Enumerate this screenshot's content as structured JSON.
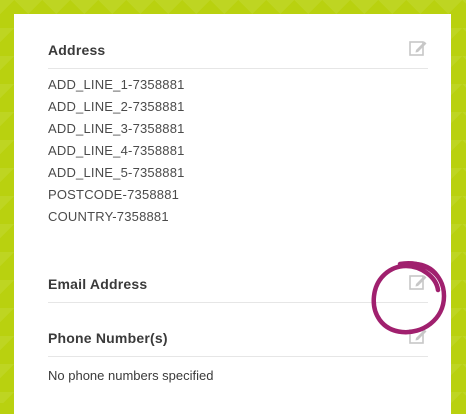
{
  "sections": {
    "address": {
      "title": "Address",
      "lines": [
        "ADD_LINE_1-7358881",
        "ADD_LINE_2-7358881",
        "ADD_LINE_3-7358881",
        "ADD_LINE_4-7358881",
        "ADD_LINE_5-7358881",
        "POSTCODE-7358881",
        "COUNTRY-7358881"
      ]
    },
    "email": {
      "title": "Email Address"
    },
    "phone": {
      "title": "Phone Number(s)",
      "empty_text": "No phone numbers specified"
    }
  },
  "icons": {
    "edit": "edit-pencil-icon"
  },
  "colors": {
    "background": "#b9d10f",
    "card": "#ffffff",
    "annotation_circle": "#a0206e",
    "icon": "#c7c7c7"
  }
}
